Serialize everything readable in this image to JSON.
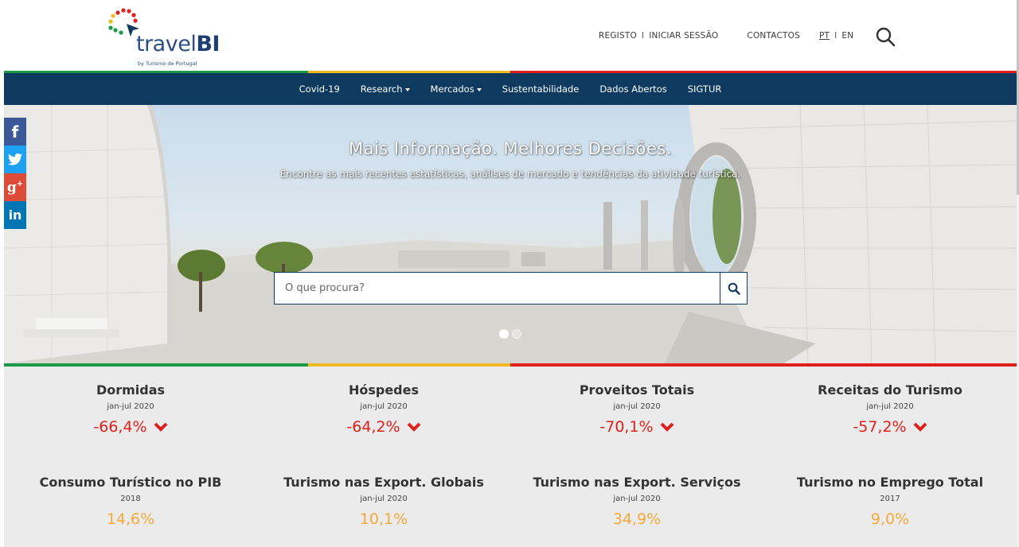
{
  "brand": {
    "logo_word": "travel",
    "logo_word_bold": "BI",
    "logo_sub": "by Turismo de Portugal",
    "colors": {
      "green": "#1a9a48",
      "yellow": "#f2b922",
      "red": "#e0201c",
      "navy": "#0d3a5e"
    }
  },
  "top_links": {
    "registo": "REGISTO",
    "divider": "I",
    "iniciar_sessao": "INICIAR SESSÃO",
    "contactos": "CONTACTOS",
    "pt": "PT",
    "en": "EN"
  },
  "nav": {
    "items": [
      {
        "label": "Covid-19",
        "dropdown": false
      },
      {
        "label": "Research",
        "dropdown": true
      },
      {
        "label": "Mercados",
        "dropdown": true
      },
      {
        "label": "Sustentabilidade",
        "dropdown": false
      },
      {
        "label": "Dados Abertos",
        "dropdown": false
      },
      {
        "label": "SIGTUR",
        "dropdown": false
      }
    ]
  },
  "hero": {
    "title": "Mais Informação. Melhores Decisões.",
    "subtitle": "Encontre as mais recentes estatísticas, análises de mercado e tendências da atividade turística.",
    "search_placeholder": "O que procura?",
    "carousel": {
      "slides": 2,
      "active": 1
    }
  },
  "social": [
    "facebook-icon",
    "twitter-icon",
    "google-plus-icon",
    "linkedin-icon"
  ],
  "stats": {
    "row1": [
      {
        "title": "Dormidas",
        "period": "jan-jul 2020",
        "value": "-66,4%",
        "trend": "down"
      },
      {
        "title": "Hóspedes",
        "period": "jan-jul 2020",
        "value": "-64,2%",
        "trend": "down"
      },
      {
        "title": "Proveitos Totais",
        "period": "jan-jul 2020",
        "value": "-70,1%",
        "trend": "down"
      },
      {
        "title": "Receitas do Turismo",
        "period": "jan-jul 2020",
        "value": "-57,2%",
        "trend": "down"
      }
    ],
    "row2": [
      {
        "title": "Consumo Turístico no PIB",
        "period": "2018",
        "value": "14,6%"
      },
      {
        "title": "Turismo nas Export. Globais",
        "period": "jan-jul 2020",
        "value": "10,1%"
      },
      {
        "title": "Turismo nas Export. Serviços",
        "period": "jan-jul 2020",
        "value": "34,9%"
      },
      {
        "title": "Turismo no Emprego Total",
        "period": "2017",
        "value": "9,0%"
      }
    ]
  }
}
